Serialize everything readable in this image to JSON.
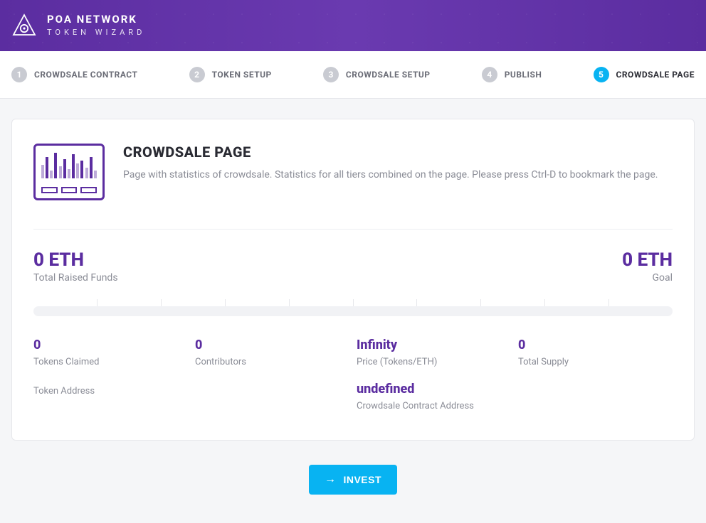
{
  "header": {
    "brand_title": "POA NETWORK",
    "brand_subtitle": "TOKEN WIZARD"
  },
  "steps": [
    {
      "num": "1",
      "label": "CROWDSALE CONTRACT",
      "active": false
    },
    {
      "num": "2",
      "label": "TOKEN SETUP",
      "active": false
    },
    {
      "num": "3",
      "label": "CROWDSALE SETUP",
      "active": false
    },
    {
      "num": "4",
      "label": "PUBLISH",
      "active": false
    },
    {
      "num": "5",
      "label": "CROWDSALE PAGE",
      "active": true
    }
  ],
  "page": {
    "title": "CROWDSALE PAGE",
    "description": "Page with statistics of crowdsale. Statistics for all tiers combined on the page. Please press Ctrl-D to bookmark the page."
  },
  "summary": {
    "raised_value": "0 ETH",
    "raised_label": "Total Raised Funds",
    "goal_value": "0 ETH",
    "goal_label": "Goal"
  },
  "stats": {
    "tokens_claimed": {
      "value": "0",
      "label": "Tokens Claimed"
    },
    "contributors": {
      "value": "0",
      "label": "Contributors"
    },
    "price": {
      "value": "Infinity",
      "label": "Price (Tokens/ETH)"
    },
    "total_supply": {
      "value": "0",
      "label": "Total Supply"
    },
    "token_address": {
      "value": "",
      "label": "Token Address"
    },
    "crowdsale_address": {
      "value": "undefined",
      "label": "Crowdsale Contract Address"
    }
  },
  "colors": {
    "brand_purple": "#5b2da0",
    "accent_blue": "#08b3f2"
  },
  "actions": {
    "invest_label": "INVEST"
  }
}
